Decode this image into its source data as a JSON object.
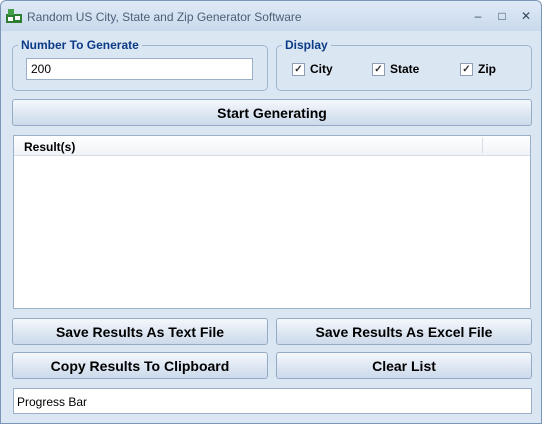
{
  "window": {
    "title": "Random US City, State and Zip Generator Software",
    "controls": {
      "minimize": "–",
      "maximize": "□",
      "close": "✕"
    }
  },
  "number_group": {
    "legend": "Number To Generate",
    "value": "200"
  },
  "display_group": {
    "legend": "Display",
    "options": [
      {
        "label": "City",
        "checked": true
      },
      {
        "label": "State",
        "checked": true
      },
      {
        "label": "Zip",
        "checked": true
      }
    ]
  },
  "buttons": {
    "start": "Start Generating",
    "save_text": "Save Results As Text File",
    "save_excel": "Save Results As Excel File",
    "copy": "Copy Results To Clipboard",
    "clear": "Clear List"
  },
  "results": {
    "column_header": "Result(s)",
    "rows": []
  },
  "progress": {
    "label": "Progress Bar"
  },
  "colors": {
    "legend": "#0b3a86",
    "background": "#dbe6f3"
  }
}
